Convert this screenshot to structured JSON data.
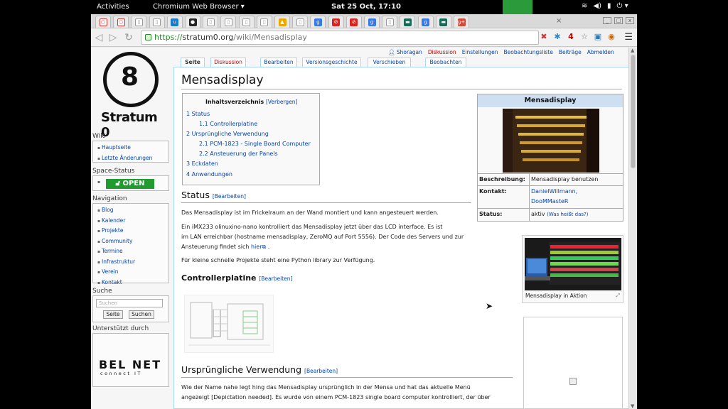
{
  "system_bar": {
    "activities": "Activities",
    "app_name": "Chromium Web Browser",
    "clock": "Sat 25 Oct, 17:10",
    "tray_icons": [
      "wifi-icon",
      "volume-icon",
      "battery-icon",
      "power-icon"
    ]
  },
  "browser": {
    "url_scheme": "https://",
    "url_host": "stratum0.org",
    "url_path": "/wiki/Mensadisplay",
    "close_glyph": "×",
    "tab_icons": [
      "opera-icon",
      "opera-icon",
      "page-icon",
      "page-icon",
      "uberspace-icon",
      "github-icon",
      "page-icon",
      "page-icon",
      "page-icon",
      "page-icon",
      "linux-icon",
      "page-icon",
      "google-icon",
      "block-icon",
      "block-icon",
      "google-icon",
      "page-icon",
      "terminal-icon",
      "google-icon",
      "terminal-icon",
      "gplus-icon"
    ],
    "extension_counter": "4"
  },
  "wiki": {
    "logo_name": "Stratum 0",
    "logo_glyph": "8",
    "sidebar": {
      "wiki_title": "Wiki",
      "wiki_links": [
        "Hauptseite",
        "Letzte Änderungen"
      ],
      "space_status_title": "Space-Status",
      "space_status_value": "OPEN",
      "navigation_title": "Navigation",
      "navigation_links": [
        "Blog",
        "Kalender",
        "Projekte",
        "Community",
        "Termine",
        "Infrastruktur",
        "Verein",
        "Kontakt"
      ],
      "search_title": "Suche",
      "search_placeholder": "Suchen",
      "search_page_button": "Seite",
      "search_button": "Suchen",
      "supported_title": "Unterstützt durch",
      "sponsor_name": "BEL NET",
      "sponsor_sub": "connect IT"
    },
    "personal_links": [
      "Shoragan",
      "Diskussion",
      "Einstellungen",
      "Beobachtungsliste",
      "Beiträge",
      "Abmelden"
    ],
    "content_tabs": [
      "Seite",
      "Diskussion",
      "Bearbeiten",
      "Versionsgeschichte",
      "Verschieben",
      "Beobachten"
    ],
    "title": "Mensadisplay",
    "toc": {
      "title": "Inhaltsverzeichnis",
      "hide": "[Verbergen]",
      "items": [
        "1 Status",
        "1.1 Controllerplatine",
        "2 Ursprüngliche Verwendung",
        "2.1 PCM-1823 - Single Board Computer",
        "2.2 Ansteuerung der Panels",
        "3 Eckdaten",
        "4 Anwendungen"
      ]
    },
    "edit_label": "[Bearbeiten]",
    "section_status": "Status",
    "status_p1": "Das Mensadisplay ist im Frickelraum an der Wand montiert und kann angesteuert werden.",
    "status_p2_l1": "Ein iMX233 olinuxino-nano kontrolliert das Mensadisplay jetzt über das LCD interface. Es ist",
    "status_p2_l2": "im LAN erreichbar (hostname mensadisplay, ZeroMQ auf Port 5556). Der Code des Servers und zur",
    "status_p2_l3": "Ansteuerung findet sich",
    "status_p2_link": "hier",
    "status_p3": "Für kleine schnelle Projekte steht eine Python library zur Verfügung.",
    "section_controller": "Controllerplatine",
    "section_usage": "Ursprüngliche Verwendung",
    "usage_p1_l1": "Wie der Name nahe legt hing das Mensadisplay ursprünglich in der Mensa und hat das aktuelle Menü",
    "usage_p1_l2": "angezeigt [Depictation needed]. Es wurde von einem PCM-1823 single board computer kontrolliert, der über",
    "infobox": {
      "title": "Mensadisplay",
      "rows": [
        {
          "label": "Beschreibung:",
          "value": "Mensadisplay benutzen"
        },
        {
          "label": "Kontakt:",
          "value_1": "DanielWillmann,",
          "value_2": "DooMMasteR"
        },
        {
          "label": "Status:",
          "value": "aktiv",
          "link": "(Was heißt das?)"
        }
      ]
    },
    "thumb_caption": "Mensadisplay in Aktion"
  }
}
